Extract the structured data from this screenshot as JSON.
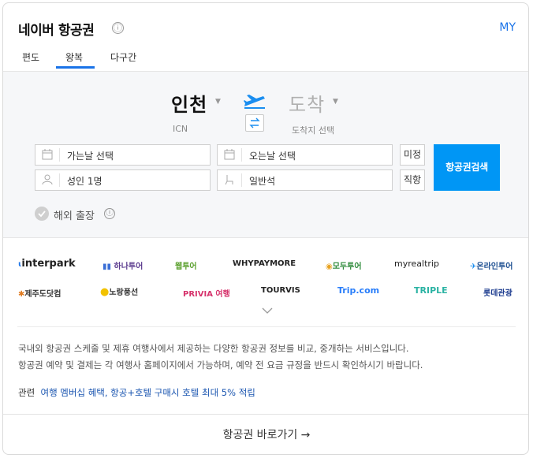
{
  "header": {
    "title": "네이버 항공권",
    "info_icon": "ⓘ",
    "my_label": "MY"
  },
  "tabs": [
    {
      "label": "편도"
    },
    {
      "label": "왕복",
      "active": true
    },
    {
      "label": "다구간"
    }
  ],
  "route": {
    "from": {
      "city": "인천",
      "code": "ICN"
    },
    "to": {
      "city": "도착",
      "code": "도착지 선택"
    }
  },
  "fields": {
    "depart_date": "가는날 선택",
    "return_date": "오는날 선택",
    "passengers": "성인 1명",
    "seat_class": "일반석",
    "undecided": "미정",
    "direct": "직항"
  },
  "search_button": "항공권검색",
  "business_trip": {
    "label": "해외 출장",
    "checked": false
  },
  "partners": {
    "row1": [
      {
        "label": "interpark",
        "color": "#222222"
      },
      {
        "label": "하나투어",
        "color": "#5c3c8f"
      },
      {
        "label": "웹투어",
        "color": "#5aa02c"
      },
      {
        "label": "WHYPAYMORE",
        "color": "#222222"
      },
      {
        "label": "모두투어",
        "color": "#2e8b3a"
      },
      {
        "label": "myrealtrip",
        "color": "#222222"
      },
      {
        "label": "온라인투어",
        "color": "#1d4f91"
      }
    ],
    "row2": [
      {
        "label": "제주도닷컴",
        "color": "#e07a1f"
      },
      {
        "label": "노랑풍선",
        "color": "#333333"
      },
      {
        "label": "PRIVIA 여행",
        "color": "#d6336c"
      },
      {
        "label": "TOURVIS",
        "color": "#222222"
      },
      {
        "label": "Trip.com",
        "color": "#287dfa"
      },
      {
        "label": "TRIPLE",
        "color": "#2bb3a3"
      },
      {
        "label": "롯데관광",
        "color": "#1d3c8f"
      }
    ]
  },
  "description": {
    "line1": "국내외 항공권 스케줄 및 제휴 여행사에서 제공하는 다양한 항공권 정보를 비교, 중개하는 서비스입니다.",
    "line2": "항공권 예약 및 결제는 각 여행사 홈페이지에서 가능하며, 예약 전 요금 규정을 반드시 확인하시기 바랍니다."
  },
  "related": {
    "prefix": "관련",
    "link": "여행 멤버십 혜택, 항공+호텔 구매시 호텔 최대 5% 적립"
  },
  "footer": {
    "goto_label": "항공권 바로가기 →"
  },
  "colors": {
    "accent": "#1a73e8",
    "search_button": "#0096f5",
    "plane": "#1a8ef0"
  }
}
